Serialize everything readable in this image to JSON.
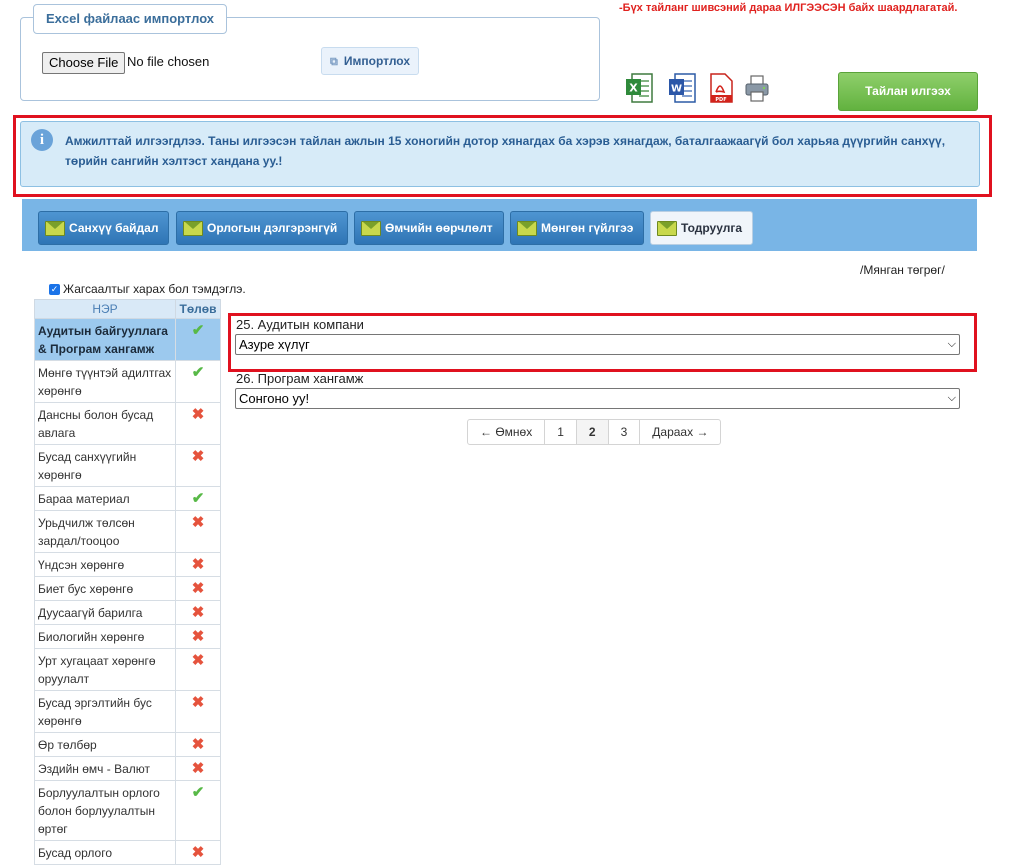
{
  "import": {
    "legend": "Excel файлаас импортлох",
    "choose_file": "Choose File",
    "no_file": "No file chosen",
    "import_button": "Импортлох"
  },
  "notice": "-Бүх тайланг шивсэний дараа ИЛГЭЭСЭН байх шаардлагатай.",
  "icons": [
    "excel-icon",
    "word-icon",
    "pdf-icon",
    "printer-icon"
  ],
  "submit_button": "Тайлан илгээх",
  "alert": {
    "line1": "Амжилттай илгээгдлээ. Таны илгээсэн тайлан ажлын 15 хоногийн дотор хянагдах ба хэрэв хянагдаж, баталгаажаагүй бол харьяа дүүргийн санхүү,",
    "line2": "төрийн сангийн хэлтэст хандана уу.!"
  },
  "tabs": [
    {
      "label": "Санхүү байдал"
    },
    {
      "label": "Орлогын дэлгэрэнгүй"
    },
    {
      "label": "Өмчийн өөрчлөлт"
    },
    {
      "label": "Мөнгөн гүйлгээ"
    },
    {
      "label": "Тодруулга"
    }
  ],
  "unit": "/Мянган төгрөг/",
  "hide_check_label": "Жагсаалтыг харах бол тэмдэглэ.",
  "table": {
    "headers": [
      "НЭР",
      "Төлөв"
    ],
    "rows": [
      {
        "name": "Аудитын байгууллага & Програм хангамж",
        "status": "ok"
      },
      {
        "name": "Мөнгө түүнтэй адилтгах хөрөнгө",
        "status": "ok"
      },
      {
        "name": "Дансны болон бусад авлага",
        "status": "bad"
      },
      {
        "name": "Бусад санхүүгийн хөрөнгө",
        "status": "bad"
      },
      {
        "name": "Бараа материал",
        "status": "ok"
      },
      {
        "name": "Урьдчилж төлсөн зардал/тооцоо",
        "status": "bad"
      },
      {
        "name": "Үндсэн хөрөнгө",
        "status": "bad"
      },
      {
        "name": "Биет бус хөрөнгө",
        "status": "bad"
      },
      {
        "name": "Дуусаагүй барилга",
        "status": "bad"
      },
      {
        "name": "Биологийн хөрөнгө",
        "status": "bad"
      },
      {
        "name": "Урт хугацаат хөрөнгө оруулалт",
        "status": "bad"
      },
      {
        "name": "Бусад эргэлтийн бус хөрөнгө",
        "status": "bad"
      },
      {
        "name": "Өр төлбөр",
        "status": "bad"
      },
      {
        "name": "Эздийн өмч - Валют",
        "status": "bad"
      },
      {
        "name": "Борлуулалтын орлого болон борлуулалтын өртөг",
        "status": "ok"
      },
      {
        "name": "Бусад орлого",
        "status": "bad"
      }
    ]
  },
  "form": {
    "field1_label": "25. Аудитын компани",
    "field1_value": "Азуре хүлүг",
    "field2_label": "26. Програм хангамж",
    "field2_value": "Сонгоно уу!"
  },
  "pager": {
    "prev": "← Өмнөх",
    "pages": [
      "1",
      "2",
      "3"
    ],
    "current": "2",
    "next": "Дараах →"
  },
  "colors": {
    "alert_frame": "#e0111f",
    "tab_bg": "#3f85c6",
    "submit": "#6bb946"
  }
}
